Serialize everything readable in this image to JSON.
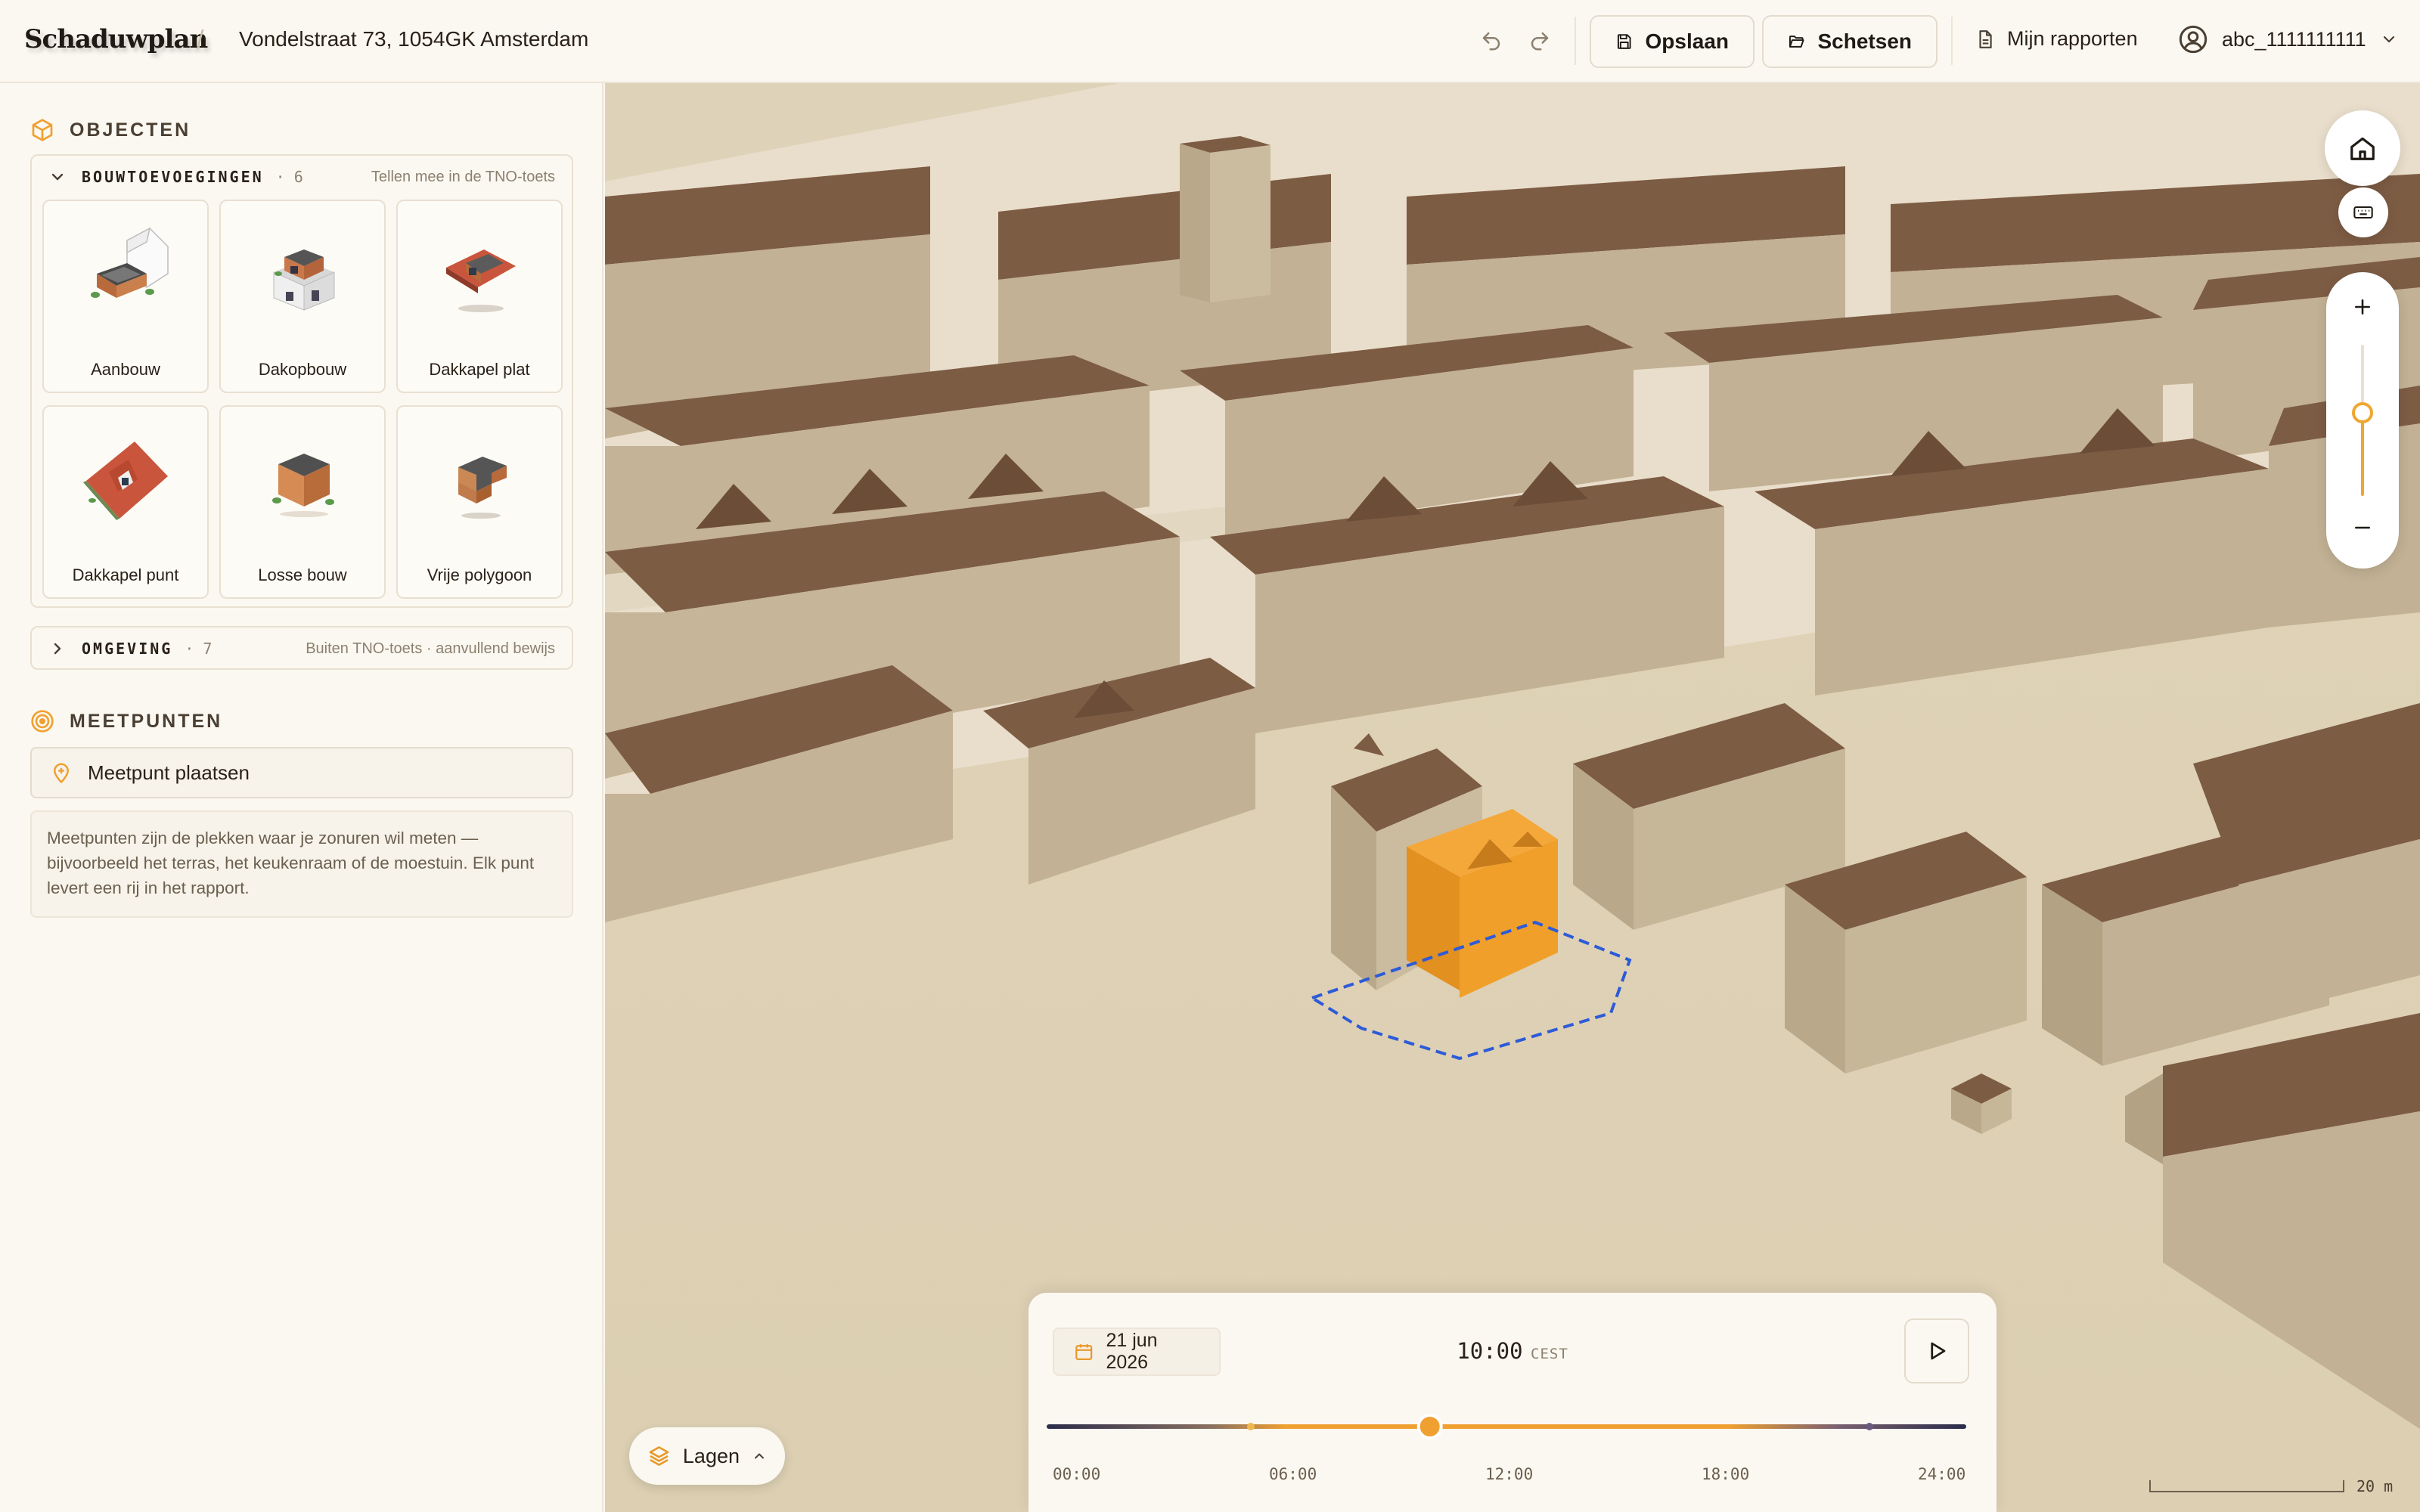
{
  "header": {
    "logo": "Schaduwplan",
    "separator": "/",
    "address": "Vondelstraat 73, 1054GK Amsterdam",
    "undo_icon": "undo-icon",
    "redo_icon": "redo-icon",
    "save_label": "Opslaan",
    "sketch_label": "Schetsen",
    "reports_label": "Mijn rapporten",
    "username": "abc_1111111111"
  },
  "sidebar": {
    "objects_title": "OBJECTEN",
    "additions": {
      "label": "BOUWTOEVOEGINGEN",
      "count": "· 6",
      "note": "Tellen mee in de TNO-toets",
      "items": [
        {
          "label": "Aanbouw",
          "icon": "aanbouw-icon"
        },
        {
          "label": "Dakopbouw",
          "icon": "dakopbouw-icon"
        },
        {
          "label": "Dakkapel plat",
          "icon": "dakkapel-plat-icon"
        },
        {
          "label": "Dakkapel punt",
          "icon": "dakkapel-punt-icon"
        },
        {
          "label": "Losse bouw",
          "icon": "losse-bouw-icon"
        },
        {
          "label": "Vrije polygoon",
          "icon": "vrije-polygoon-icon"
        }
      ]
    },
    "environment": {
      "label": "OMGEVING",
      "count": "· 7",
      "note": "Buiten TNO-toets · aanvullend bewijs"
    },
    "measure_title": "MEETPUNTEN",
    "measure_button": "Meetpunt plaatsen",
    "measure_desc": "Meetpunten zijn de plekken waar je zonuren wil meten — bijvoorbeeld het terras, het keukenraam of de moestuin. Elk punt levert een rij in het rapport."
  },
  "map": {
    "zoom_level_fraction": 0.45,
    "layers_label": "Lagen",
    "scale_label": "20 m",
    "colors": {
      "ground": "#ddd0b4",
      "wall": "#c2b194",
      "roof": "#7d5c44",
      "selected": "#f0a02a",
      "outline": "#2d5bd8"
    }
  },
  "timebar": {
    "date": "21 jun 2026",
    "time": "10:00",
    "timezone": "CEST",
    "position_fraction": 0.4167,
    "ticks": [
      "00:00",
      "06:00",
      "12:00",
      "18:00",
      "24:00"
    ]
  }
}
